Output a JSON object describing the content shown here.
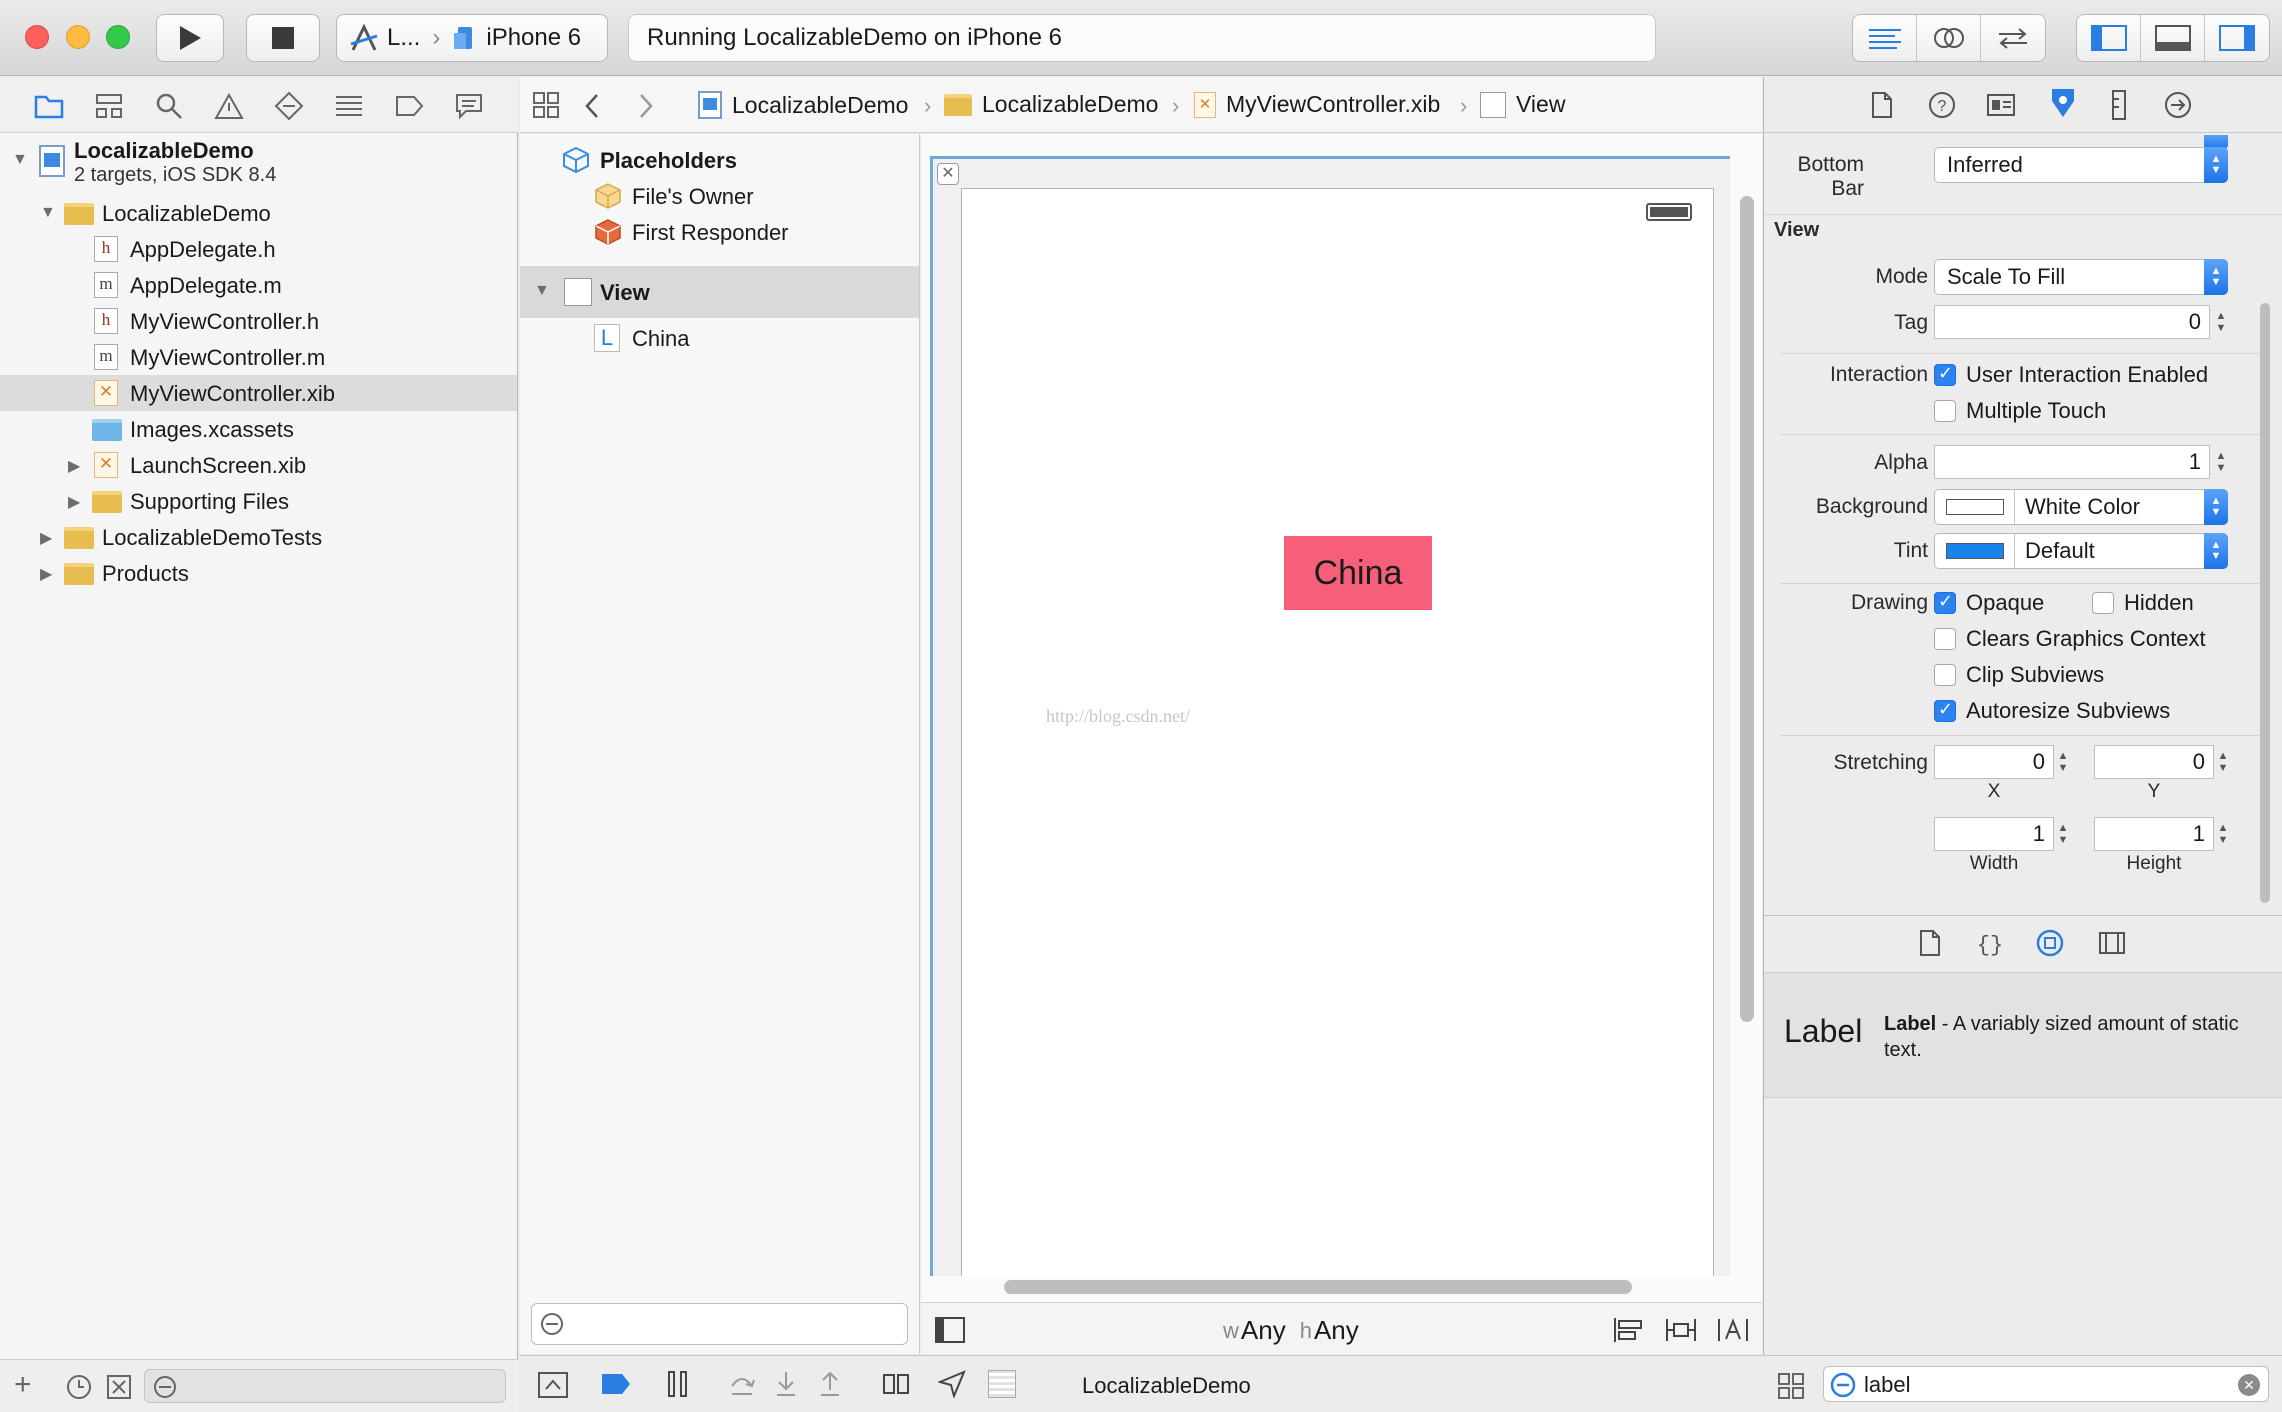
{
  "toolbar": {
    "scheme_target": "L...",
    "device": "iPhone 6",
    "activity_status": "Running LocalizableDemo on iPhone 6"
  },
  "navigator": {
    "project_name": "LocalizableDemo",
    "project_subtitle": "2 targets, iOS SDK 8.4",
    "items": [
      {
        "label": "LocalizableDemo",
        "icon": "folder-icon"
      },
      {
        "label": "AppDelegate.h",
        "icon": "header-file-icon"
      },
      {
        "label": "AppDelegate.m",
        "icon": "implementation-file-icon"
      },
      {
        "label": "MyViewController.h",
        "icon": "header-file-icon"
      },
      {
        "label": "MyViewController.m",
        "icon": "implementation-file-icon"
      },
      {
        "label": "MyViewController.xib",
        "icon": "xib-file-icon"
      },
      {
        "label": "Images.xcassets",
        "icon": "asset-catalog-icon"
      },
      {
        "label": "LaunchScreen.xib",
        "icon": "xib-file-icon"
      },
      {
        "label": "Supporting Files",
        "icon": "folder-icon"
      },
      {
        "label": "LocalizableDemoTests",
        "icon": "folder-icon"
      },
      {
        "label": "Products",
        "icon": "folder-icon"
      }
    ]
  },
  "jumpbar": {
    "crumbs": [
      "LocalizableDemo",
      "LocalizableDemo",
      "MyViewController.xib",
      "View"
    ]
  },
  "outline": {
    "placeholders": "Placeholders",
    "files_owner": "File's Owner",
    "first_responder": "First Responder",
    "view": "View",
    "label_item": "China"
  },
  "canvas": {
    "label_text": "China",
    "label_color": "#f65e79",
    "watermark": "http://blog.csdn.net/",
    "size_class_w_prefix": "w",
    "size_class_w": "Any",
    "size_class_h_prefix": "h",
    "size_class_h": "Any"
  },
  "debug": {
    "target": "LocalizableDemo"
  },
  "inspector": {
    "bottom_bar_label": "Bottom Bar",
    "bottom_bar_value": "Inferred",
    "section_title": "View",
    "mode_label": "Mode",
    "mode_value": "Scale To Fill",
    "tag_label": "Tag",
    "tag_value": "0",
    "interaction_label": "Interaction",
    "user_interaction": "User Interaction Enabled",
    "multiple_touch": "Multiple Touch",
    "alpha_label": "Alpha",
    "alpha_value": "1",
    "background_label": "Background",
    "background_value": "White Color",
    "tint_label": "Tint",
    "tint_value": "Default",
    "tint_color": "#1a82ec",
    "drawing_label": "Drawing",
    "opaque": "Opaque",
    "hidden": "Hidden",
    "clears_graphics": "Clears Graphics Context",
    "clip_subviews": "Clip Subviews",
    "autoresize_subviews": "Autoresize Subviews",
    "stretching_label": "Stretching",
    "stretch_x": "0",
    "stretch_y": "0",
    "stretch_w": "1",
    "stretch_h": "1",
    "x_caption": "X",
    "y_caption": "Y",
    "width_caption": "Width",
    "height_caption": "Height"
  },
  "library": {
    "item_icon_text": "Label",
    "item_title": "Label",
    "item_desc": " - A variably sized amount of static text.",
    "filter_value": "label"
  }
}
